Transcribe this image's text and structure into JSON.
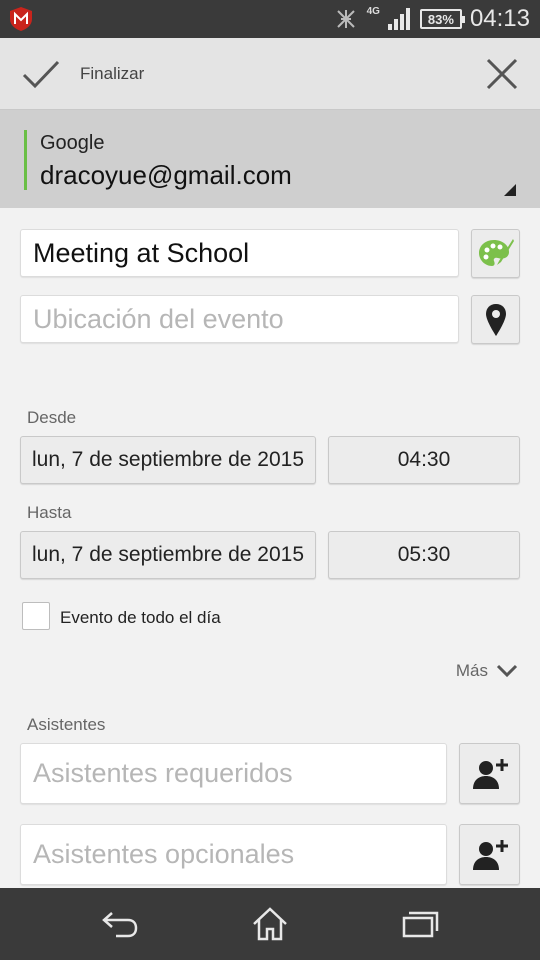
{
  "status_bar": {
    "time": "04:13",
    "battery": "83%",
    "network": "4G",
    "icons": [
      "mcafee-icon",
      "bluetooth-off-icon",
      "signal-icon",
      "battery-icon"
    ]
  },
  "action_bar": {
    "done_label": "Finalizar",
    "done_icon": "checkmark-icon",
    "close_icon": "close-icon"
  },
  "account": {
    "provider": "Google",
    "email": "dracoyue@gmail.com",
    "accent": "#6abf45"
  },
  "event": {
    "title_value": "Meeting at School",
    "color_icon": "palette-icon",
    "location_placeholder": "Ubicación del evento",
    "location_icon": "map-pin-icon"
  },
  "from": {
    "label": "Desde",
    "date": "lun, 7 de septiembre de 2015",
    "time": "04:30"
  },
  "to": {
    "label": "Hasta",
    "date": "lun, 7 de septiembre de 2015",
    "time": "05:30"
  },
  "all_day": {
    "label": "Evento de todo el día",
    "checked": false
  },
  "more": {
    "label": "Más",
    "icon": "chevron-down-icon"
  },
  "attendees": {
    "label": "Asistentes",
    "required_placeholder": "Asistentes requeridos",
    "optional_placeholder": "Asistentes opcionales",
    "add_icon": "add-person-icon"
  },
  "nav_bar": {
    "icons": [
      "back-icon",
      "home-icon",
      "recents-icon"
    ]
  }
}
